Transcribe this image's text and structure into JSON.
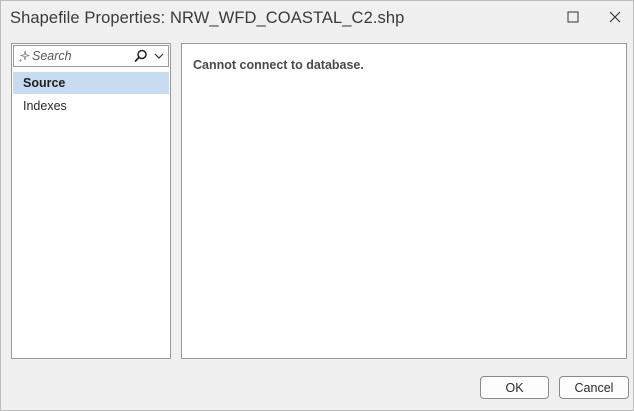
{
  "window": {
    "title": "Shapefile Properties: NRW_WFD_COASTAL_C2.shp",
    "controls": [
      "maximize-icon",
      "close-icon"
    ]
  },
  "sidebar": {
    "search": {
      "placeholder": "Search",
      "value": "",
      "icons": [
        "sparkle-icon",
        "search-icon",
        "chevron-down-icon"
      ]
    },
    "items": [
      {
        "label": "Source",
        "selected": true
      },
      {
        "label": "Indexes",
        "selected": false
      }
    ]
  },
  "main": {
    "message": "Cannot connect to database."
  },
  "footer": {
    "ok_label": "OK",
    "cancel_label": "Cancel"
  },
  "colors": {
    "selected_item_bg": "#c7dcf0",
    "dialog_bg": "#f0f0f0",
    "panel_border": "#9a9a9a"
  }
}
